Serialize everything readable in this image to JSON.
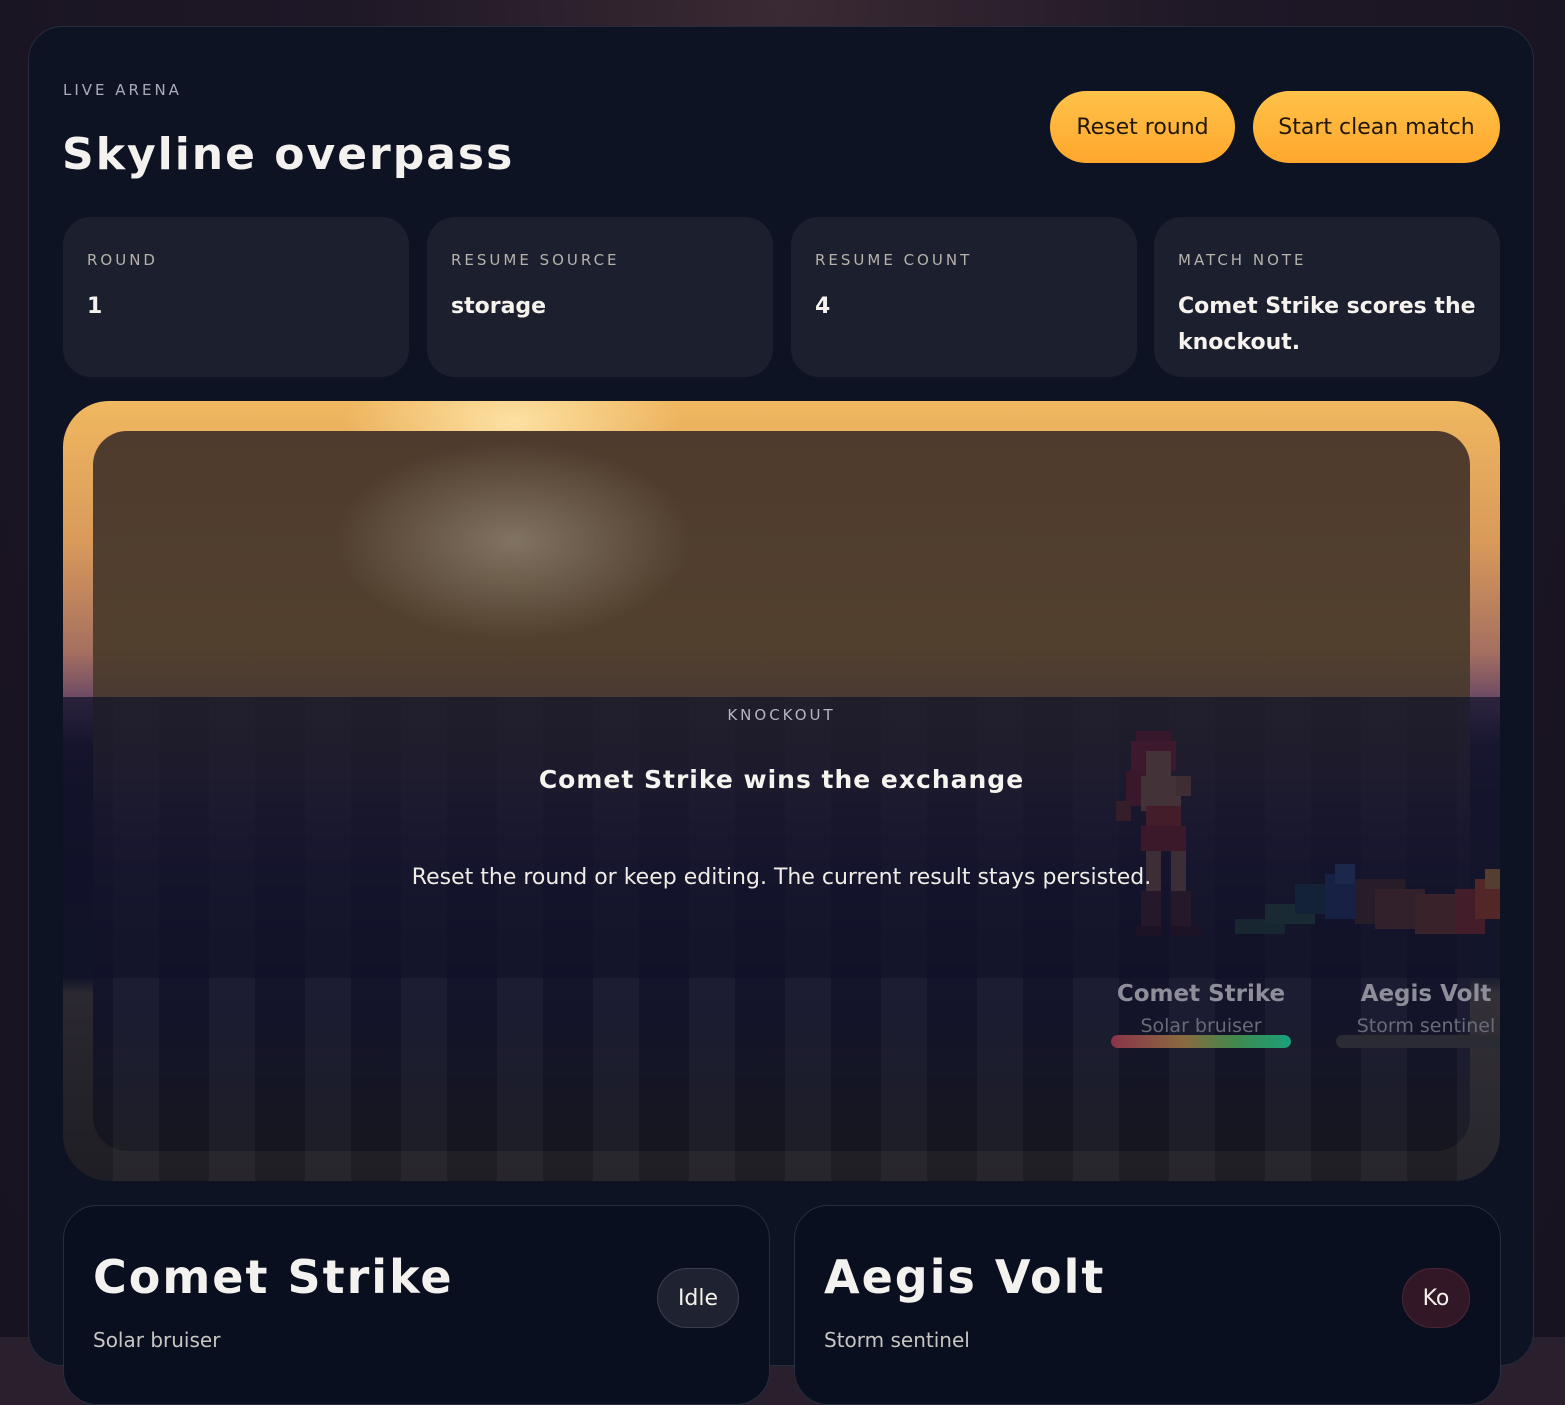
{
  "header": {
    "eyebrow": "LIVE ARENA",
    "title": "Skyline overpass",
    "reset_label": "Reset round",
    "start_label": "Start clean match"
  },
  "stats": [
    {
      "label": "ROUND",
      "value": "1"
    },
    {
      "label": "RESUME SOURCE",
      "value": "storage"
    },
    {
      "label": "RESUME COUNT",
      "value": "4"
    },
    {
      "label": "MATCH NOTE",
      "value": "Comet Strike scores the knockout."
    }
  ],
  "arena": {
    "overlay_label": "KNOCKOUT",
    "overlay_title": "Comet Strike wins the exchange",
    "overlay_message": "Reset the round or keep editing. The current result stays persisted.",
    "fighters": [
      {
        "name": "Comet Strike",
        "subtitle": "Solar bruiser",
        "health": 1.0
      },
      {
        "name": "Aegis Volt",
        "subtitle": "Storm sentinel",
        "health": 0.0
      }
    ]
  },
  "cards": [
    {
      "name": "Comet Strike",
      "subtitle": "Solar bruiser",
      "status": "Idle"
    },
    {
      "name": "Aegis Volt",
      "subtitle": "Storm sentinel",
      "status": "Ko"
    }
  ],
  "colors": {
    "accent": "#ffb23a",
    "panel": "#0e1324",
    "stat_card": "#1c1f2d"
  }
}
